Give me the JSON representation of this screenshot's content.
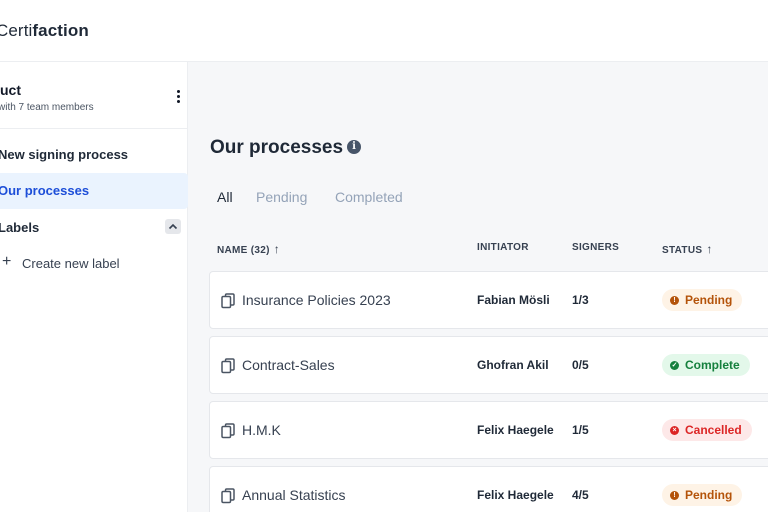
{
  "app": {
    "logo_light": "Certi",
    "logo_bold": "faction"
  },
  "sidebar": {
    "team_name": "uct",
    "team_sub": "with 7 team members",
    "items": [
      {
        "label": "New signing process"
      },
      {
        "label": "Our processes"
      }
    ],
    "labels_heading": "Labels",
    "create_label": "Create new label"
  },
  "main": {
    "title": "Our processes",
    "tabs": [
      {
        "label": "All"
      },
      {
        "label": "Pending"
      },
      {
        "label": "Completed"
      }
    ],
    "columns": {
      "name": "NAME (32)",
      "initiator": "INITIATOR",
      "signers": "SIGNERS",
      "status": "STATUS"
    },
    "rows": [
      {
        "name": "Insurance Policies 2023",
        "initiator": "Fabian Mösli",
        "signers": "1/3",
        "status": "Pending"
      },
      {
        "name": "Contract-Sales",
        "initiator": "Ghofran Akil",
        "signers": "0/5",
        "status": "Complete"
      },
      {
        "name": "H.M.K",
        "initiator": "Felix Haegele",
        "signers": "1/5",
        "status": "Cancelled"
      },
      {
        "name": "Annual Statistics",
        "initiator": "Felix Haegele",
        "signers": "4/5",
        "status": "Pending"
      }
    ]
  },
  "colors": {
    "accent": "#1d4ed8",
    "active_bg": "#eaf3fe",
    "pending": "#b45309",
    "complete": "#15803d",
    "cancelled": "#dc2626"
  },
  "icons": {
    "info": "info-icon",
    "document": "document-copy-icon",
    "sort": "arrow-up-icon",
    "menu": "kebab-menu-icon",
    "collapse": "chevron-up-icon",
    "add": "plus-icon"
  }
}
